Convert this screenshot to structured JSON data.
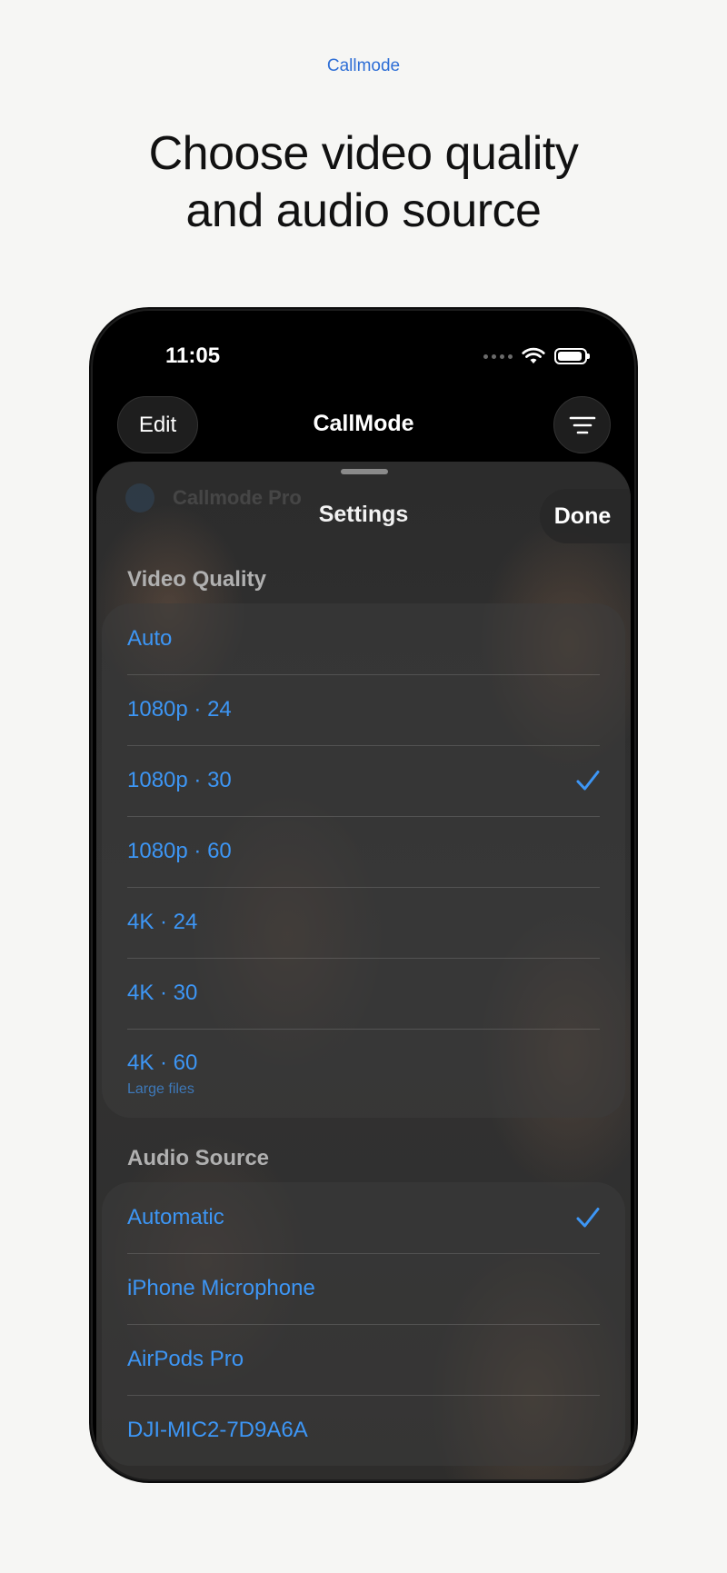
{
  "brand": "Callmode",
  "headline_line1": "Choose video quality",
  "headline_line2": "and audio source",
  "status": {
    "time": "11:05"
  },
  "nav": {
    "edit_label": "Edit",
    "title": "CallMode"
  },
  "background_item": "Callmode Pro",
  "sheet": {
    "title": "Settings",
    "done_label": "Done"
  },
  "video": {
    "header": "Video Quality",
    "options": [
      {
        "label": "Auto",
        "selected": false
      },
      {
        "label": "1080p · 24",
        "selected": false
      },
      {
        "label": "1080p · 30",
        "selected": true
      },
      {
        "label": "1080p · 60",
        "selected": false
      },
      {
        "label": "4K · 24",
        "selected": false
      },
      {
        "label": "4K · 30",
        "selected": false
      },
      {
        "label": "4K · 60",
        "sublabel": "Large files",
        "selected": false
      }
    ]
  },
  "audio": {
    "header": "Audio Source",
    "options": [
      {
        "label": "Automatic",
        "selected": true
      },
      {
        "label": "iPhone Microphone",
        "selected": false
      },
      {
        "label": "AirPods Pro",
        "selected": false
      },
      {
        "label": "DJI-MIC2-7D9A6A",
        "selected": false
      }
    ]
  },
  "colors": {
    "accent": "#3d96f5",
    "brand": "#2f6fd6",
    "page_background": "#f6f6f4"
  },
  "icons": [
    "wifi-icon",
    "battery-icon",
    "menu-icon",
    "checkmark-icon"
  ]
}
